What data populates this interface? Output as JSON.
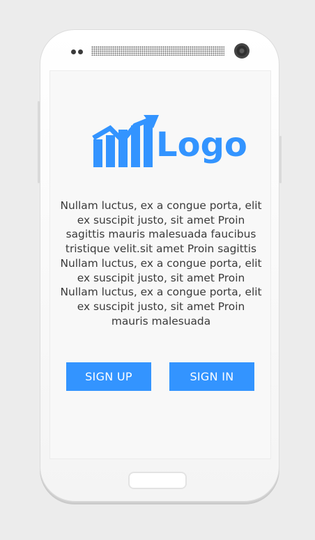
{
  "logo": {
    "text": "Logo",
    "color": "#3394ff"
  },
  "description": "Nullam luctus, ex a congue porta, elit ex suscipit justo, sit amet Proin sagittis mauris malesuada faucibus tristique velit.sit amet Proin sagittis Nullam luctus, ex a congue porta, elit ex suscipit justo, sit amet Proin Nullam luctus, ex a congue porta, elit ex suscipit justo, sit amet Proin mauris malesuada",
  "buttons": {
    "signup_label": "SIGN UP",
    "signin_label": "SIGN IN",
    "color": "#3394ff"
  },
  "device": {
    "icons": [
      "sensor-icon",
      "speaker-icon",
      "camera-icon",
      "home-button-icon"
    ]
  }
}
